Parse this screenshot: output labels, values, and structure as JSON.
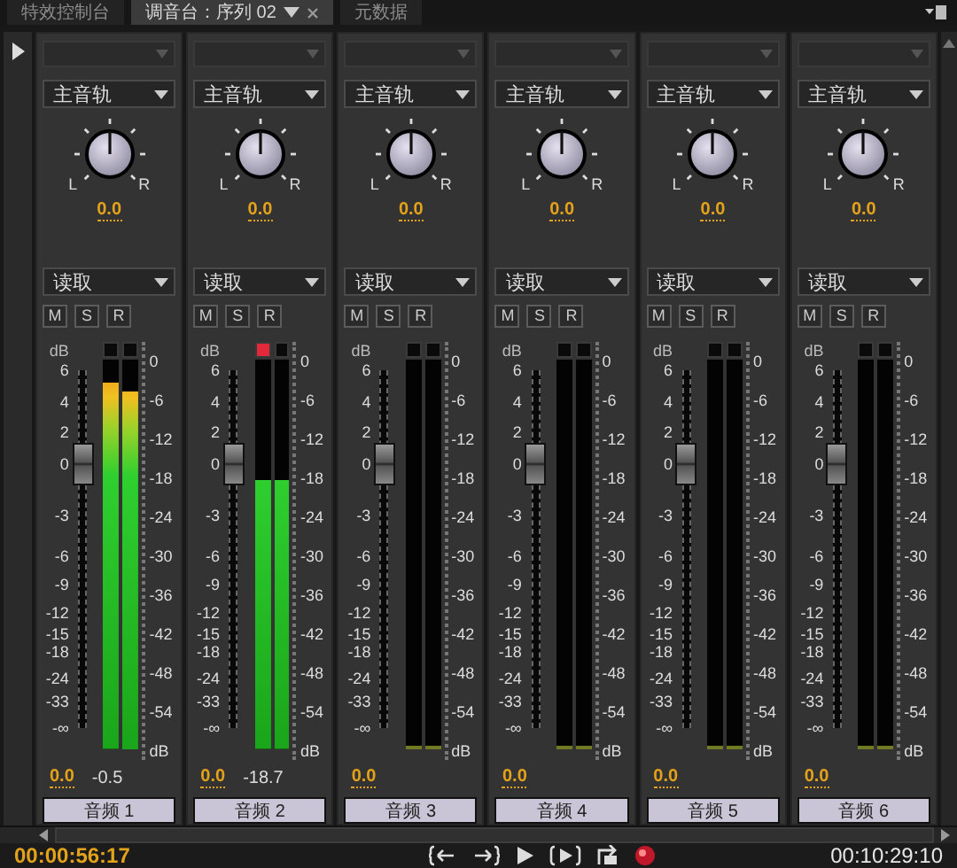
{
  "tabs": [
    {
      "label": "特效控制台",
      "selected": false,
      "closable": false
    },
    {
      "label": "调音台：序列 02",
      "selected": true,
      "closable": true
    },
    {
      "label": "元数据",
      "selected": false,
      "closable": false
    }
  ],
  "channels": [
    {
      "output": "主音轨",
      "pan_labels": [
        "L",
        "R"
      ],
      "pan": "0.0",
      "automation": "读取",
      "buttons": [
        {
          "label": "M",
          "on": false
        },
        {
          "label": "S",
          "on": false
        },
        {
          "label": "R",
          "on": false
        }
      ],
      "fader_unit": "dB",
      "fader_scale": [
        "6",
        "4",
        "2",
        "0",
        "-3",
        "-6",
        "-9",
        "-12",
        "-15",
        "-18",
        "-24",
        "-33",
        "-∞"
      ],
      "fader": {
        "level": 0.736
      },
      "meters": [
        {
          "level": 0.94,
          "clip": false
        },
        {
          "level": 0.92,
          "clip": false
        }
      ],
      "meter_scale": [
        "0",
        "-6",
        "-12",
        "-18",
        "-24",
        "-30",
        "-36",
        "-42",
        "-48",
        "-54",
        "dB"
      ],
      "volume": "0.0",
      "peak": "-0.5",
      "name": "音频 1"
    },
    {
      "output": "主音轨",
      "pan_labels": [
        "L",
        "R"
      ],
      "pan": "0.0",
      "automation": "读取",
      "buttons": [
        {
          "label": "M",
          "on": false
        },
        {
          "label": "S",
          "on": false
        },
        {
          "label": "R",
          "on": false
        }
      ],
      "fader_unit": "dB",
      "fader_scale": [
        "6",
        "4",
        "2",
        "0",
        "-3",
        "-6",
        "-9",
        "-12",
        "-15",
        "-18",
        "-24",
        "-33",
        "-∞"
      ],
      "fader": {
        "level": 0.736
      },
      "meters": [
        {
          "level": 0.69,
          "clip": true
        },
        {
          "level": 0.69,
          "clip": false
        }
      ],
      "meter_scale": [
        "0",
        "-6",
        "-12",
        "-18",
        "-24",
        "-30",
        "-36",
        "-42",
        "-48",
        "-54",
        "dB"
      ],
      "volume": "0.0",
      "peak": "-18.7",
      "name": "音频 2"
    },
    {
      "output": "主音轨",
      "pan_labels": [
        "L",
        "R"
      ],
      "pan": "0.0",
      "automation": "读取",
      "buttons": [
        {
          "label": "M",
          "on": false
        },
        {
          "label": "S",
          "on": false
        },
        {
          "label": "R",
          "on": false
        }
      ],
      "fader_unit": "dB",
      "fader_scale": [
        "6",
        "4",
        "2",
        "0",
        "-3",
        "-6",
        "-9",
        "-12",
        "-15",
        "-18",
        "-24",
        "-33",
        "-∞"
      ],
      "fader": {
        "level": 0.736
      },
      "meters": [
        {
          "level": 0,
          "clip": false
        },
        {
          "level": 0,
          "clip": false
        }
      ],
      "meter_scale": [
        "0",
        "-6",
        "-12",
        "-18",
        "-24",
        "-30",
        "-36",
        "-42",
        "-48",
        "-54",
        "dB"
      ],
      "volume": "0.0",
      "name": "音频 3"
    },
    {
      "output": "主音轨",
      "pan_labels": [
        "L",
        "R"
      ],
      "pan": "0.0",
      "automation": "读取",
      "buttons": [
        {
          "label": "M",
          "on": false
        },
        {
          "label": "S",
          "on": false
        },
        {
          "label": "R",
          "on": false
        }
      ],
      "fader_unit": "dB",
      "fader_scale": [
        "6",
        "4",
        "2",
        "0",
        "-3",
        "-6",
        "-9",
        "-12",
        "-15",
        "-18",
        "-24",
        "-33",
        "-∞"
      ],
      "fader": {
        "level": 0.736
      },
      "meters": [
        {
          "level": 0,
          "clip": false
        },
        {
          "level": 0,
          "clip": false
        }
      ],
      "meter_scale": [
        "0",
        "-6",
        "-12",
        "-18",
        "-24",
        "-30",
        "-36",
        "-42",
        "-48",
        "-54",
        "dB"
      ],
      "volume": "0.0",
      "name": "音频 4"
    },
    {
      "output": "主音轨",
      "pan_labels": [
        "L",
        "R"
      ],
      "pan": "0.0",
      "automation": "读取",
      "buttons": [
        {
          "label": "M",
          "on": false
        },
        {
          "label": "S",
          "on": false
        },
        {
          "label": "R",
          "on": false
        }
      ],
      "fader_unit": "dB",
      "fader_scale": [
        "6",
        "4",
        "2",
        "0",
        "-3",
        "-6",
        "-9",
        "-12",
        "-15",
        "-18",
        "-24",
        "-33",
        "-∞"
      ],
      "fader": {
        "level": 0.736
      },
      "meters": [
        {
          "level": 0,
          "clip": false
        },
        {
          "level": 0,
          "clip": false
        }
      ],
      "meter_scale": [
        "0",
        "-6",
        "-12",
        "-18",
        "-24",
        "-30",
        "-36",
        "-42",
        "-48",
        "-54",
        "dB"
      ],
      "volume": "0.0",
      "name": "音频 5"
    },
    {
      "output": "主音轨",
      "pan_labels": [
        "L",
        "R"
      ],
      "pan": "0.0",
      "automation": "读取",
      "buttons": [
        {
          "label": "M",
          "on": false
        },
        {
          "label": "S",
          "on": false
        },
        {
          "label": "R",
          "on": false
        }
      ],
      "fader_unit": "dB",
      "fader_scale": [
        "6",
        "4",
        "2",
        "0",
        "-3",
        "-6",
        "-9",
        "-12",
        "-15",
        "-18",
        "-24",
        "-33",
        "-∞"
      ],
      "fader": {
        "level": 0.736
      },
      "meters": [
        {
          "level": 0,
          "clip": false
        },
        {
          "level": 0,
          "clip": false
        }
      ],
      "meter_scale": [
        "0",
        "-6",
        "-12",
        "-18",
        "-24",
        "-30",
        "-36",
        "-42",
        "-48",
        "-54",
        "dB"
      ],
      "volume": "0.0",
      "name": "音频 6"
    }
  ],
  "timecode_current": "00:00:56:17",
  "timecode_duration": "00:10:29:10"
}
